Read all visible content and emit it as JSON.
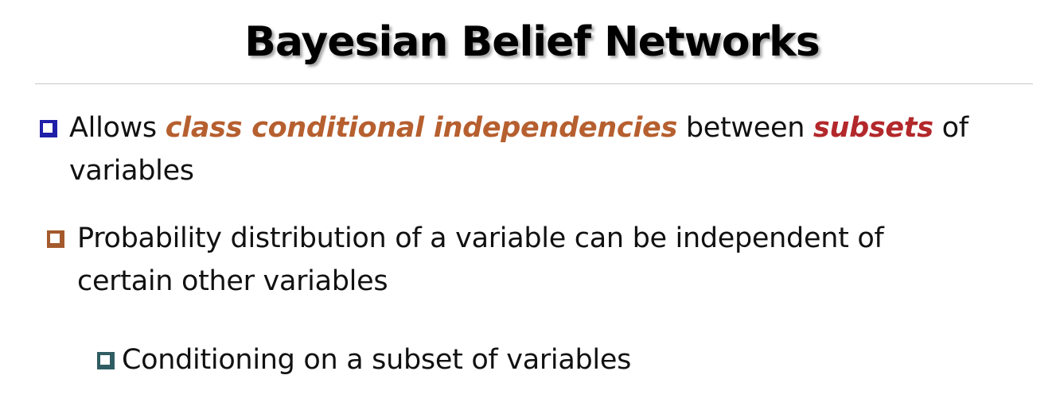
{
  "title": "Bayesian Belief Networks",
  "colors": {
    "bullet1_marker": "#1f1fa8",
    "bullet2_marker": "#a35a2c",
    "bullet3_marker": "#2f5d63",
    "emphasis_orange": "#b65f2f",
    "emphasis_red": "#b3282b"
  },
  "bullets": [
    {
      "marker_icon": "hollow-square-bullet",
      "parts": {
        "a": "Allows ",
        "b": "class conditional independencies",
        "c": " between ",
        "d": "subsets",
        "e": " of variables"
      }
    },
    {
      "marker_icon": "hollow-square-bullet",
      "text": "Probability distribution of a variable can be independent of certain other variables"
    },
    {
      "marker_icon": "hollow-square-bullet",
      "text": "Conditioning on a subset of variables"
    }
  ]
}
